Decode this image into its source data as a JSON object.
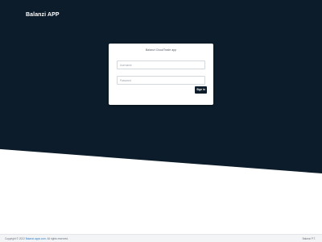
{
  "app": {
    "title": "Balanzi APP"
  },
  "login": {
    "title": "Balanzi CloudTrade app",
    "username_placeholder": "Username",
    "password_placeholder": "Password",
    "signin_label": "Sign in"
  },
  "footer": {
    "copyright_prefix": "Copyright © 2022",
    "link_text": "Balanzi.apps.com",
    "copyright_suffix": ". All rights reserved.",
    "right_text": "Balanzi P.T."
  },
  "colors": {
    "header_bg": "#0c1c2a",
    "button_bg": "#0c1c2a",
    "link": "#2f80c9"
  }
}
